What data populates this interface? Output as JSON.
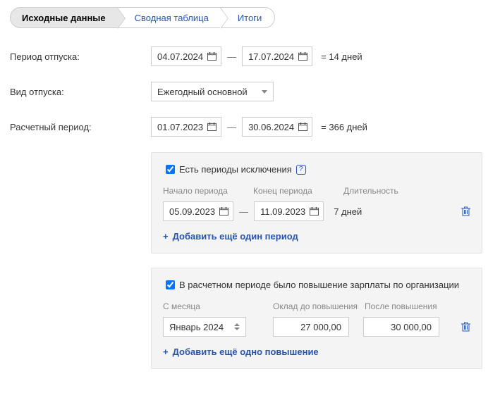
{
  "breadcrumb": {
    "steps": [
      {
        "label": "Исходные данные",
        "active": true
      },
      {
        "label": "Сводная таблица",
        "active": false
      },
      {
        "label": "Итоги",
        "active": false
      }
    ]
  },
  "labels": {
    "vacation_period": "Период отпуска:",
    "vacation_type": "Вид отпуска:",
    "calc_period": "Расчетный период:"
  },
  "vacation_period": {
    "from": "04.07.2024",
    "to": "17.07.2024",
    "equals": "= 14 дней"
  },
  "vacation_type": {
    "selected": "Ежегодный основной"
  },
  "calc_period": {
    "from": "01.07.2023",
    "to": "30.06.2024",
    "equals": "= 366 дней"
  },
  "exclusions": {
    "checkbox_label": "Есть периоды исключения",
    "cols": {
      "start": "Начало периода",
      "end": "Конец периода",
      "duration": "Длительность"
    },
    "rows": [
      {
        "from": "05.09.2023",
        "to": "11.09.2023",
        "duration": "7 дней"
      }
    ],
    "add_label": "Добавить ещё один период"
  },
  "raise": {
    "checkbox_label": "В расчетном периоде было повышение зарплаты по организации",
    "cols": {
      "month": "С месяца",
      "before": "Оклад до повышения",
      "after": "После повышения"
    },
    "rows": [
      {
        "month": "Январь 2024",
        "before": "27 000,00",
        "after": "30 000,00"
      }
    ],
    "add_label": "Добавить ещё одно повышение"
  },
  "glyphs": {
    "dash": "—",
    "plus": "+",
    "help": "?"
  }
}
